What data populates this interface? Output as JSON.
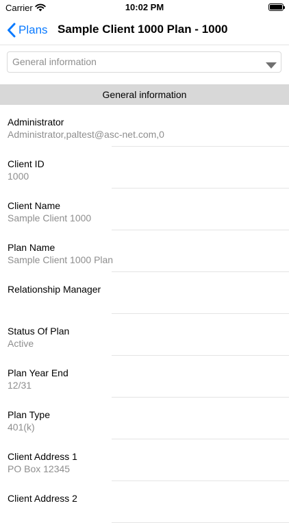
{
  "status_bar": {
    "carrier": "Carrier",
    "time": "10:02 PM",
    "wifi_icon": "wifi-icon",
    "battery_icon": "battery-icon"
  },
  "nav": {
    "back_label": "Plans",
    "back_icon": "chevron-left-icon",
    "title": "Sample Client 1000 Plan - 1000",
    "accent_color": "#0a7aff"
  },
  "picker": {
    "selected": "General information",
    "icon": "triangle-down-icon"
  },
  "section": {
    "header": "General information",
    "fields": [
      {
        "label": "Administrator",
        "value": "Administrator,paltest@asc-net.com,0"
      },
      {
        "label": "Client ID",
        "value": "1000"
      },
      {
        "label": "Client Name",
        "value": "Sample Client 1000"
      },
      {
        "label": "Plan Name",
        "value": "Sample Client 1000 Plan"
      },
      {
        "label": "Relationship Manager",
        "value": ""
      },
      {
        "label": "Status Of Plan",
        "value": "Active"
      },
      {
        "label": "Plan Year End",
        "value": "12/31"
      },
      {
        "label": "Plan Type",
        "value": "401(k)"
      },
      {
        "label": "Client Address 1",
        "value": "PO Box 12345"
      },
      {
        "label": "Client Address 2",
        "value": ""
      }
    ]
  }
}
